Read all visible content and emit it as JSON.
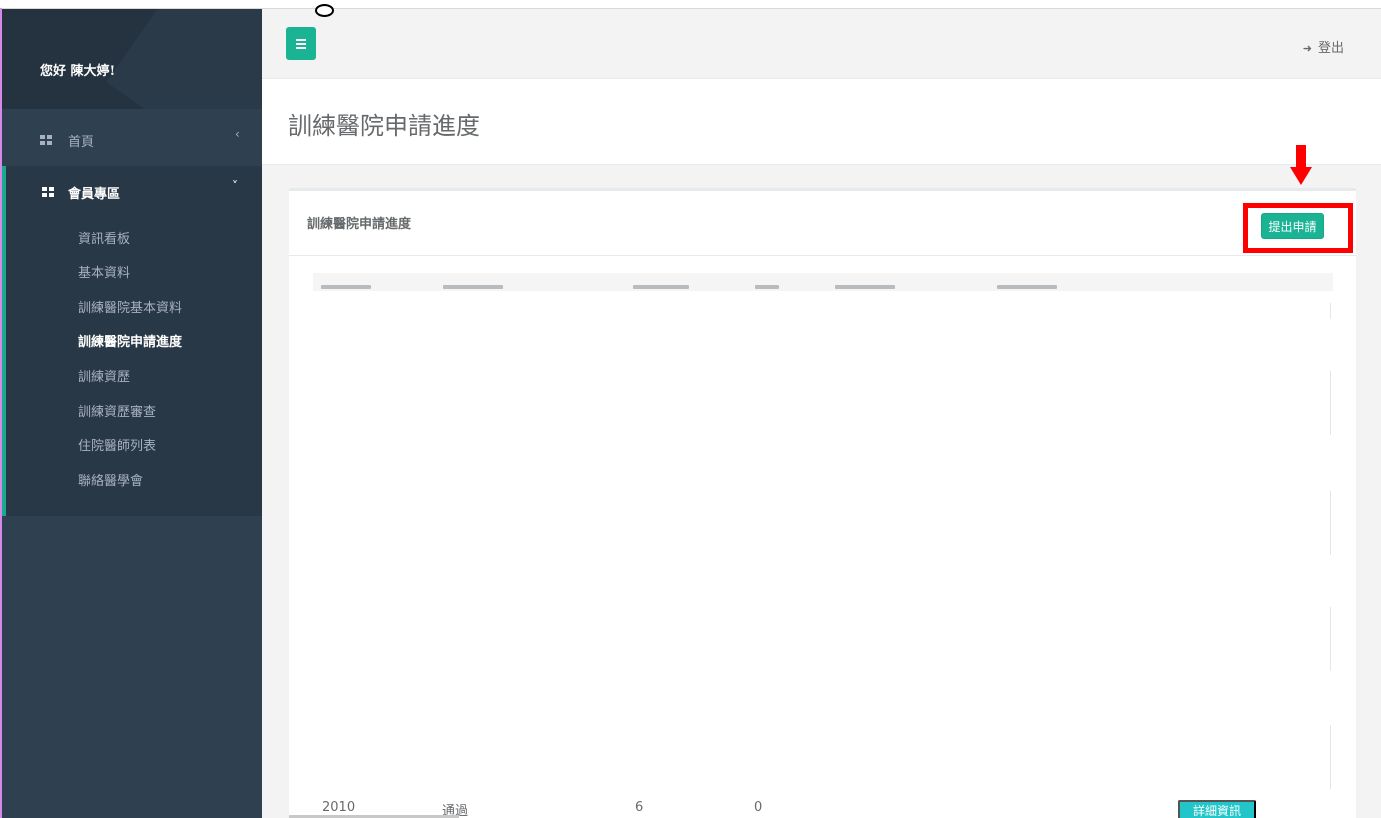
{
  "sidebar": {
    "greeting": "您好 陳大婷!",
    "home_label": "首頁",
    "home_chevron": "‹",
    "member_label": "會員專區",
    "member_chevron": "˅",
    "items": [
      {
        "label": "資訊看板",
        "active": false
      },
      {
        "label": "基本資料",
        "active": false
      },
      {
        "label": "訓練醫院基本資料",
        "active": false
      },
      {
        "label": "訓練醫院申請進度",
        "active": true
      },
      {
        "label": "訓練資歷",
        "active": false
      },
      {
        "label": "訓練資歷審查",
        "active": false
      },
      {
        "label": "住院醫師列表",
        "active": false
      },
      {
        "label": "聯絡醫學會",
        "active": false
      }
    ]
  },
  "topbar": {
    "menu_icon": "hamburger-icon",
    "logout_icon": "sign-out-icon",
    "logout_label": "登出"
  },
  "page": {
    "title": "訓練醫院申請進度"
  },
  "card": {
    "title": "訓練醫院申請進度",
    "apply_button": "提出申請",
    "rows": [
      {
        "year": "2010",
        "status": "通過",
        "count_a": "6",
        "count_b": "0",
        "detail_button": "詳細資訊"
      }
    ]
  },
  "colors": {
    "sidebar_bg": "#2f4050",
    "accent": "#1ab394",
    "info": "#23c6c8",
    "annotation": "#ff0000"
  }
}
